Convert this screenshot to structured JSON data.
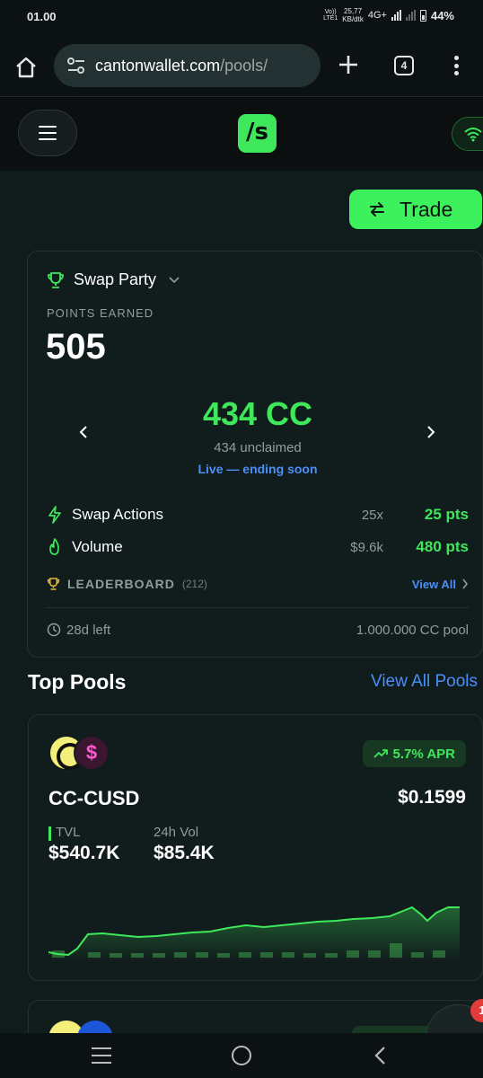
{
  "status_bar": {
    "time": "01.00",
    "volte_line1": "Vo))",
    "volte_line2": "LTE1",
    "speed_line1": "25,77",
    "speed_line2": "KB/dtk",
    "network": "4G+",
    "battery": "44%"
  },
  "browser": {
    "url_host": "cantonwallet.com",
    "url_path": "/pools/",
    "tab_count": "4"
  },
  "header": {
    "logo": "/s"
  },
  "trade_button": {
    "label": "Trade"
  },
  "swap_party": {
    "title": "Swap Party",
    "points_label": "POINTS EARNED",
    "points_value": "505",
    "reward_amount": "434 CC",
    "reward_unclaimed": "434 unclaimed",
    "status": "Live — ending soon",
    "stats": [
      {
        "label": "Swap Actions",
        "count": "25x",
        "points": "25 pts"
      },
      {
        "label": "Volume",
        "count": "$9.6k",
        "points": "480 pts"
      }
    ],
    "leaderboard_label": "LEADERBOARD",
    "leaderboard_count": "(212)",
    "view_all": "View All",
    "time_left": "28d left",
    "pool_size": "1.000.000 CC pool"
  },
  "top_pools": {
    "title": "Top Pools",
    "view_all": "View All Pools",
    "pools": [
      {
        "name": "CC-CUSD",
        "apr": "5.7% APR",
        "price": "$0.1599",
        "tvl_label": "TVL",
        "tvl": "$540.7K",
        "vol_label": "24h Vol",
        "vol": "$85.4K",
        "coin2_symbol": "$"
      }
    ]
  },
  "fab": {
    "notification_count": "1"
  },
  "colors": {
    "accent_green": "#3ee85a",
    "link_blue": "#4b8ff7",
    "background": "#101b1c",
    "card": "#111c1d"
  },
  "icons": [
    "home-icon",
    "site-settings-icon",
    "plus-icon",
    "more-icon",
    "menu-icon",
    "wifi-icon",
    "swap-arrows-icon",
    "trophy-icon",
    "chevron-down-icon",
    "chevron-left-icon",
    "chevron-right-icon",
    "lightning-icon",
    "flame-icon",
    "clock-icon",
    "trending-up-icon"
  ]
}
